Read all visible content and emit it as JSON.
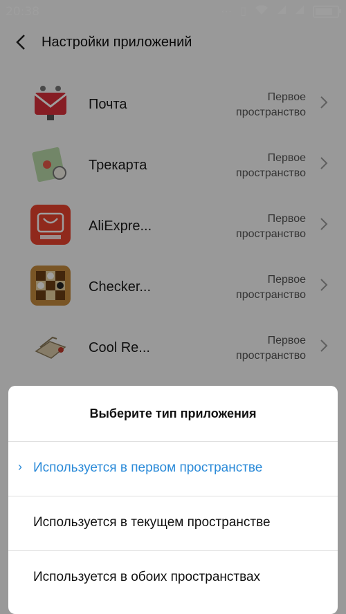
{
  "status_bar": {
    "time": "20:38",
    "battery_level": 0.85
  },
  "header": {
    "title": "Настройки приложений"
  },
  "apps": [
    {
      "name": "Почта",
      "status_line1": "Первое",
      "status_line2": "пространство",
      "icon": "mail-icon"
    },
    {
      "name": "Трекарта",
      "status_line1": "Первое",
      "status_line2": "пространство",
      "icon": "map-icon"
    },
    {
      "name": "AliExpre...",
      "status_line1": "Первое",
      "status_line2": "пространство",
      "icon": "aliexpress-icon"
    },
    {
      "name": "Checker...",
      "status_line1": "Первое",
      "status_line2": "пространство",
      "icon": "checkers-icon"
    },
    {
      "name": "Cool Re...",
      "status_line1": "Первое",
      "status_line2": "пространство",
      "icon": "cool-reader-icon"
    }
  ],
  "sheet": {
    "title": "Выберите тип приложения",
    "options": [
      {
        "label": "Используется в первом пространстве",
        "selected": true
      },
      {
        "label": "Используется в текущем пространстве",
        "selected": false
      },
      {
        "label": "Используется в обоих пространствах",
        "selected": false
      }
    ]
  },
  "colors": {
    "accent": "#2a8ad8",
    "aliexpress_red": "#e8432e",
    "mail_red": "#d9303a"
  }
}
